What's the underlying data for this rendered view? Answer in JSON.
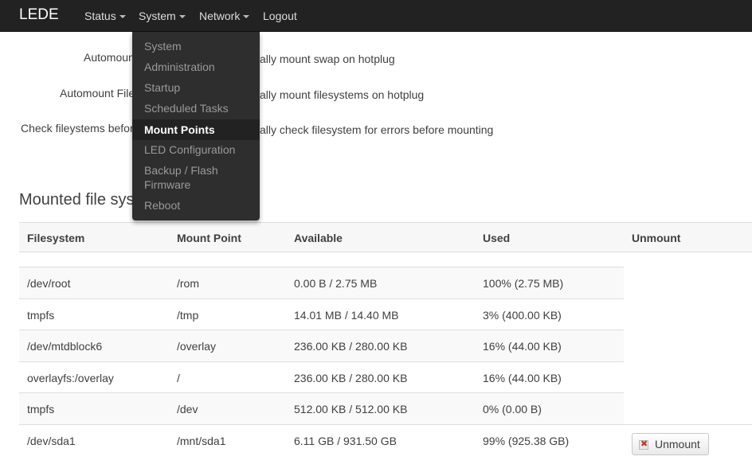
{
  "nav": {
    "brand": "LEDE",
    "items": [
      {
        "label": "Status"
      },
      {
        "label": "System"
      },
      {
        "label": "Network"
      },
      {
        "label": "Logout"
      }
    ]
  },
  "dropdown": {
    "items": [
      {
        "label": "System"
      },
      {
        "label": "Administration"
      },
      {
        "label": "Startup"
      },
      {
        "label": "Scheduled Tasks"
      },
      {
        "label": "Mount Points",
        "active": true
      },
      {
        "label": "LED Configuration"
      },
      {
        "label": "Backup / Flash"
      },
      {
        "label": "Firmware"
      },
      {
        "label": "Reboot"
      }
    ]
  },
  "options": [
    {
      "label": "Automount",
      "desc": "ally mount swap on hotplug"
    },
    {
      "label": "Automount Files",
      "desc": "ally mount filesystems on hotplug"
    },
    {
      "label": "Check fileystems before",
      "desc": "ally check filesystem for errors before mounting"
    }
  ],
  "section_title": "Mounted file sys",
  "table": {
    "headers": [
      "Filesystem",
      "Mount Point",
      "Available",
      "Used",
      "Unmount"
    ],
    "rows": [
      {
        "fs": "/dev/root",
        "mount": "/rom",
        "avail": "0.00 B / 2.75 MB",
        "used": "100% (2.75 MB)"
      },
      {
        "fs": "tmpfs",
        "mount": "/tmp",
        "avail": "14.01 MB / 14.40 MB",
        "used": "3% (400.00 KB)"
      },
      {
        "fs": "/dev/mtdblock6",
        "mount": "/overlay",
        "avail": "236.00 KB / 280.00 KB",
        "used": "16% (44.00 KB)"
      },
      {
        "fs": "overlayfs:/overlay",
        "mount": "/",
        "avail": "236.00 KB / 280.00 KB",
        "used": "16% (44.00 KB)"
      },
      {
        "fs": "tmpfs",
        "mount": "/dev",
        "avail": "512.00 KB / 512.00 KB",
        "used": "0% (0.00 B)"
      },
      {
        "fs": "/dev/sda1",
        "mount": "/mnt/sda1",
        "avail": "6.11 GB / 931.50 GB",
        "used": "99% (925.38 GB)"
      }
    ],
    "unmount_label": "Unmount"
  }
}
